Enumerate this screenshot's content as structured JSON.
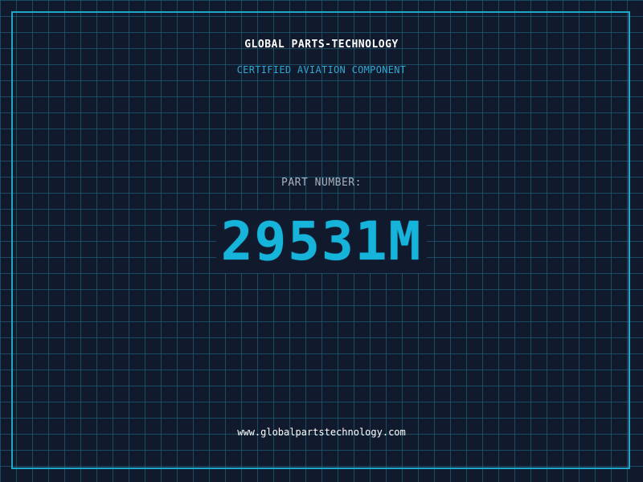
{
  "header": {
    "company_name": "GLOBAL PARTS-TECHNOLOGY",
    "tagline": "CERTIFIED AVIATION COMPONENT"
  },
  "part": {
    "label": "PART NUMBER:",
    "number": "29531M"
  },
  "footer": {
    "website": "www.globalpartstechnology.com"
  },
  "colors": {
    "background": "#111a2d",
    "grid": "#22708c",
    "accent": "#16b3da",
    "frame": "#1fa7c9"
  }
}
